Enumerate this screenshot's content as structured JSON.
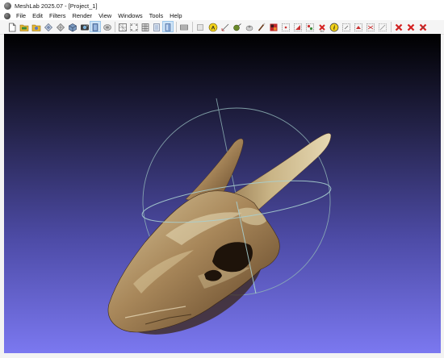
{
  "window": {
    "title": "MeshLab 2025.07 - [Project_1]"
  },
  "menu": {
    "items": [
      "File",
      "Edit",
      "Filters",
      "Render",
      "View",
      "Windows",
      "Tools",
      "Help"
    ]
  },
  "toolbar": {
    "buttons": [
      {
        "icon": "new-project-icon",
        "selected": false
      },
      {
        "icon": "open-project-icon",
        "selected": false
      },
      {
        "icon": "import-mesh-icon",
        "selected": false
      },
      {
        "icon": "reload-icon",
        "selected": false
      },
      {
        "icon": "export-mesh-icon",
        "selected": false
      },
      {
        "icon": "snapshot-icon",
        "selected": false
      },
      {
        "icon": "layers-icon",
        "selected": false
      },
      {
        "icon": "bounding-box-icon",
        "selected": true
      },
      {
        "icon": "points-render-icon",
        "selected": false
      },
      {
        "icon": "wireframe-icon",
        "selected": false
      },
      {
        "icon": "vertex-render-icon",
        "selected": false
      },
      {
        "icon": "flat-lines-icon",
        "selected": false
      },
      {
        "icon": "flat-shading-icon",
        "selected": false
      },
      {
        "icon": "smooth-shading-icon",
        "selected": true
      },
      {
        "icon": "lighting-icon",
        "selected": false
      },
      {
        "icon": "double-side-icon",
        "selected": false
      },
      {
        "icon": "annotation-icon",
        "selected": false
      },
      {
        "icon": "measure-icon",
        "selected": false
      },
      {
        "icon": "align-icon",
        "selected": false
      },
      {
        "icon": "point-picker-icon",
        "selected": false
      },
      {
        "icon": "paint-icon",
        "selected": false
      },
      {
        "icon": "texture-icon",
        "selected": false
      },
      {
        "icon": "select-vertices-icon",
        "selected": false
      },
      {
        "icon": "select-faces-icon",
        "selected": false
      },
      {
        "icon": "select-connected-icon",
        "selected": false
      },
      {
        "icon": "delete-faces-icon",
        "selected": false
      },
      {
        "icon": "info-icon",
        "selected": false
      },
      {
        "icon": "select-region-icon",
        "selected": false
      },
      {
        "icon": "manipulator-icon",
        "selected": false
      },
      {
        "icon": "mutual-align-icon",
        "selected": false
      },
      {
        "icon": "delete-vertices-icon",
        "selected": false
      },
      {
        "icon": "delete-selected-faces-icon",
        "selected": false
      },
      {
        "icon": "delete-selection-icon",
        "selected": false
      }
    ]
  },
  "viewport": {
    "background_top": "#000000",
    "background_bottom": "#7b78f0",
    "trackball_color": "#8fb3b6",
    "mesh_subject": "skull-mesh"
  }
}
